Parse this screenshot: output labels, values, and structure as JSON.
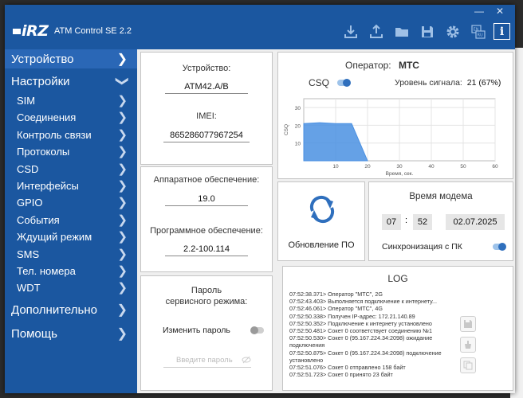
{
  "app": {
    "logo": "iRZ",
    "title": "ATM Control SE 2.2"
  },
  "window_controls": [
    "—",
    "✕"
  ],
  "toolbar": {
    "icons": [
      "download-icon",
      "upload-icon",
      "folder-icon",
      "save-icon",
      "gear-icon",
      "language-icon",
      "info-icon"
    ],
    "info_label": "i",
    "lang_label": "EN RU"
  },
  "sidebar": {
    "device": "Устройство",
    "settings": "Настройки",
    "items": [
      "SIM",
      "Соединения",
      "Контроль связи",
      "Протоколы",
      "CSD",
      "Интерфейсы",
      "GPIO",
      "События",
      "Ждущий режим",
      "SMS",
      "Тел. номера",
      "WDT"
    ],
    "additional": "Дополнительно",
    "help": "Помощь"
  },
  "device_panel": {
    "device_label": "Устройство:",
    "device_value": "ATM42.A/B",
    "imei_label": "IMEI:",
    "imei_value": "865286077967254"
  },
  "hw_panel": {
    "hw_label": "Аппаратное обеспечение:",
    "hw_value": "19.0",
    "sw_label": "Программное обеспечение:",
    "sw_value": "2.2-100.114"
  },
  "password_panel": {
    "title_line1": "Пароль",
    "title_line2": "сервисного режима:",
    "change_label": "Изменить пароль",
    "change_enabled": false,
    "input_placeholder": "Введите пароль"
  },
  "operator_panel": {
    "operator_label": "Оператор:",
    "operator_value": "МТС",
    "csq_label": "CSQ",
    "csq_enabled": true,
    "signal_label": "Уровень сигнала:",
    "signal_value": "21 (67%)"
  },
  "chart_data": {
    "type": "area",
    "x": [
      0,
      5,
      10,
      15,
      20
    ],
    "series": [
      {
        "values": [
          21,
          21.5,
          21,
          21,
          0
        ]
      }
    ],
    "xlabel": "Время, сек.",
    "ylabel": "CSQ",
    "xlim": [
      0,
      60
    ],
    "ylim": [
      0,
      35
    ],
    "xticks": [
      "10",
      "20",
      "30",
      "40",
      "50",
      "60"
    ],
    "yticks": [
      "10",
      "20",
      "30"
    ],
    "grid": true,
    "color": "#4a90e2"
  },
  "update_panel": {
    "label": "Обновление ПО"
  },
  "modem_time_panel": {
    "title": "Время модема",
    "hour": "07",
    "minute": "52",
    "separator": ":",
    "date": "02.07.2025",
    "sync_label": "Синхронизация с ПК",
    "sync_enabled": true
  },
  "log_panel": {
    "title": "LOG",
    "lines": [
      "07:52:38.371> Оператор \"МТС\", 2G",
      "07:52:43.403> Выполняется подключение к интернету...",
      "07:52:46.061> Оператор \"МТС\", 4G",
      "07:52:50.338> Получен IP-адрес: 172.21.140.89",
      "07:52:50.352> Подключение к интернету установлено",
      "07:52:50.481> Сокет 0 соответствует соединению №1",
      "07:52:50.530> Сокет 0 (95.167.224.34:2098) ожидание",
      "подключения",
      "07:52:50.875> Сокет 0 (95.167.224.34:2098) подключение",
      "установлено",
      "07:52:51.076> Сокет 0 отправлено 158 байт",
      "07:52:51.723> Сокет 0 принято 23 байт"
    ],
    "buttons": [
      "save-log-icon",
      "clear-log-icon",
      "copy-log-icon"
    ]
  }
}
